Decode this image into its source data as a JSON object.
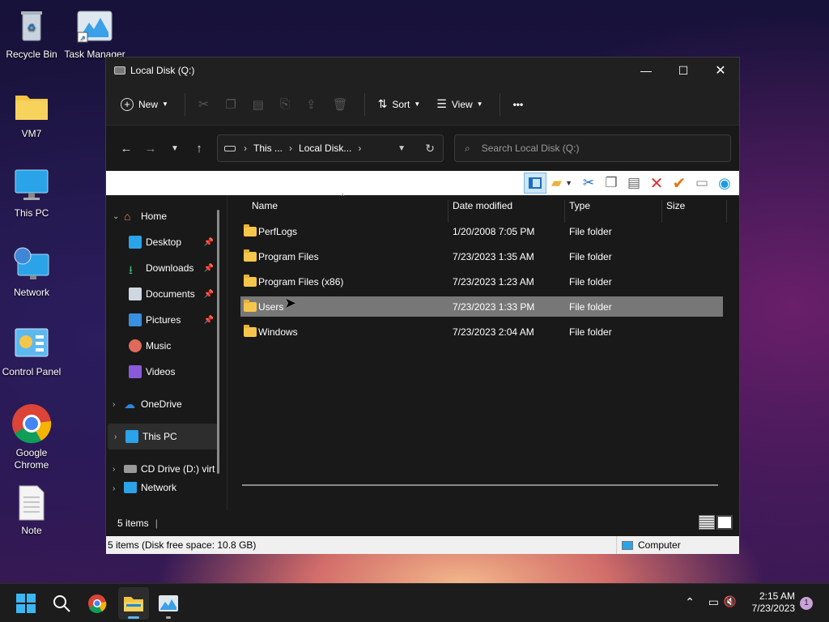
{
  "desktop": {
    "icons": [
      {
        "label": "Recycle Bin"
      },
      {
        "label": "Task Manager"
      },
      {
        "label": "VM7"
      },
      {
        "label": "This PC"
      },
      {
        "label": "Network"
      },
      {
        "label": "Control Panel"
      },
      {
        "label": "Google Chrome"
      },
      {
        "label": "Note"
      }
    ]
  },
  "window": {
    "title": "Local Disk (Q:)",
    "controls": {
      "minimize": "—",
      "maximize": "☐",
      "close": "✕"
    },
    "commandbar": {
      "new_label": "New",
      "sort_label": "Sort",
      "view_label": "View",
      "more_label": "•••"
    },
    "address": {
      "crumbs": [
        "This ...",
        "Local Disk..."
      ],
      "search_placeholder": "Search Local Disk (Q:)"
    },
    "nav": {
      "items": [
        {
          "label": "Home"
        },
        {
          "label": "Desktop"
        },
        {
          "label": "Downloads"
        },
        {
          "label": "Documents"
        },
        {
          "label": "Pictures"
        },
        {
          "label": "Music"
        },
        {
          "label": "Videos"
        },
        {
          "label": "OneDrive"
        },
        {
          "label": "This PC"
        },
        {
          "label": "CD Drive (D:) virt"
        },
        {
          "label": "Network"
        }
      ]
    },
    "columns": {
      "name": "Name",
      "date": "Date modified",
      "type": "Type",
      "size": "Size"
    },
    "files": [
      {
        "name": "PerfLogs",
        "date": "1/20/2008 7:05 PM",
        "type": "File folder"
      },
      {
        "name": "Program Files",
        "date": "7/23/2023 1:35 AM",
        "type": "File folder"
      },
      {
        "name": "Program Files (x86)",
        "date": "7/23/2023 1:23 AM",
        "type": "File folder"
      },
      {
        "name": "Users",
        "date": "7/23/2023 1:33 PM",
        "type": "File folder"
      },
      {
        "name": "Windows",
        "date": "7/23/2023 2:04 AM",
        "type": "File folder"
      }
    ],
    "status": {
      "count": "5 items"
    },
    "legacy_status": {
      "left": "5 items (Disk free space: 10.8 GB)",
      "right": "Computer"
    }
  },
  "taskbar": {
    "time": "2:15 AM",
    "date": "7/23/2023",
    "notification_count": "1"
  },
  "colors": {
    "accent": "#0078d4",
    "folder": "#f5c64a",
    "selection": "#777777"
  }
}
